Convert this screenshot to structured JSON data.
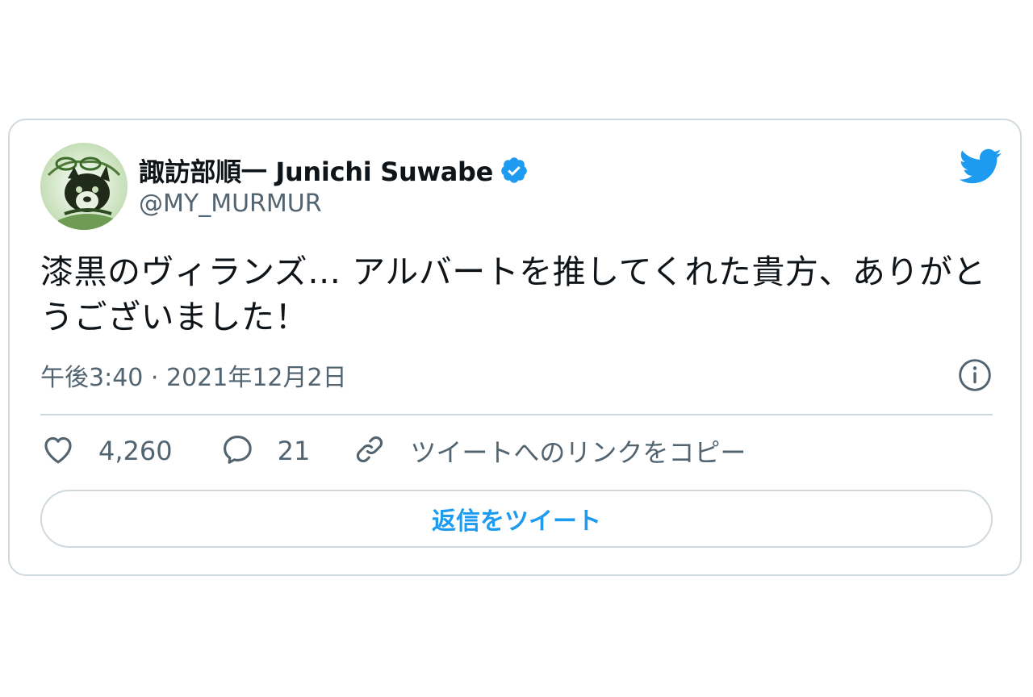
{
  "author": {
    "display_name": "諏訪部順一 Junichi Suwabe",
    "handle": "@MY_MURMUR",
    "verified": true
  },
  "tweet": {
    "text": "漆黒のヴィランズ… アルバートを推してくれた貴方、ありがとうございました！",
    "timestamp": "午後3:40 · 2021年12月2日"
  },
  "actions": {
    "likes": "4,260",
    "replies": "21",
    "copy_link_label": "ツイートへのリンクをコピー"
  },
  "reply_button_label": "返信をツイート",
  "colors": {
    "brand": "#1d9bf0",
    "text_primary": "#0f1419",
    "text_secondary": "#536471",
    "border": "#cfd9de"
  },
  "icons": {
    "verified": "verified-badge-icon",
    "brand": "twitter-bird-icon",
    "info": "info-icon",
    "like": "heart-icon",
    "reply": "speech-bubble-icon",
    "link": "link-icon"
  }
}
